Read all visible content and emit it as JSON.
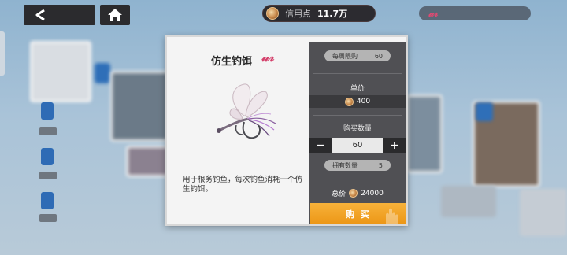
{
  "topbar": {
    "back_icon": "chevron-left-icon",
    "home_icon": "home-icon",
    "credits": {
      "icon": "credit-coin-icon",
      "label": "信用点",
      "value": "11.7万"
    }
  },
  "dialog": {
    "item": {
      "name": "仿生钓饵",
      "brand_icon": "brand-logo-icon",
      "description": "用于根务钓鱼，每次钓鱼消耗一个仿生钓饵。"
    },
    "purchase": {
      "weekly_limit_label": "每周限购",
      "weekly_limit_value": "60",
      "unit_price_label": "单价",
      "unit_price": "400",
      "quantity_label": "购买数量",
      "quantity": "60",
      "decrease_label": "−",
      "increase_label": "+",
      "owned_label": "拥有数量",
      "owned_value": "5",
      "total_label": "总价",
      "total_value": "24000",
      "buy_label": "购 买"
    }
  },
  "colors": {
    "buy_button": "#f0a024",
    "panel_dark": "#505054",
    "brand_pink": "#d43f6a"
  }
}
